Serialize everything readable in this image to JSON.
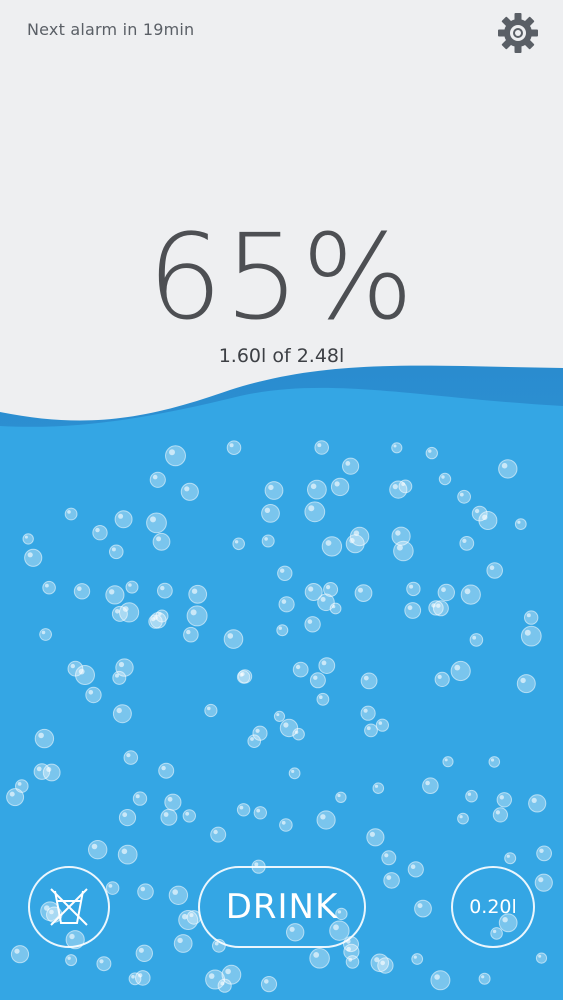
{
  "header": {
    "alarm_text": "Next alarm in 19min",
    "settings_icon": "gear-icon"
  },
  "progress": {
    "percent_text": "65%",
    "percent_value": 65,
    "amount_text": "1.60l of 2.48l"
  },
  "controls": {
    "no_drink_icon": "no-glass-icon",
    "drink_label": "DRINK",
    "volume_label": "0.20l"
  },
  "colors": {
    "background": "#eeeff1",
    "water": "#34a6e4",
    "water_wave": "#2b8fd3",
    "text_dark": "#4d4f53",
    "gear": "#5a5f66"
  }
}
